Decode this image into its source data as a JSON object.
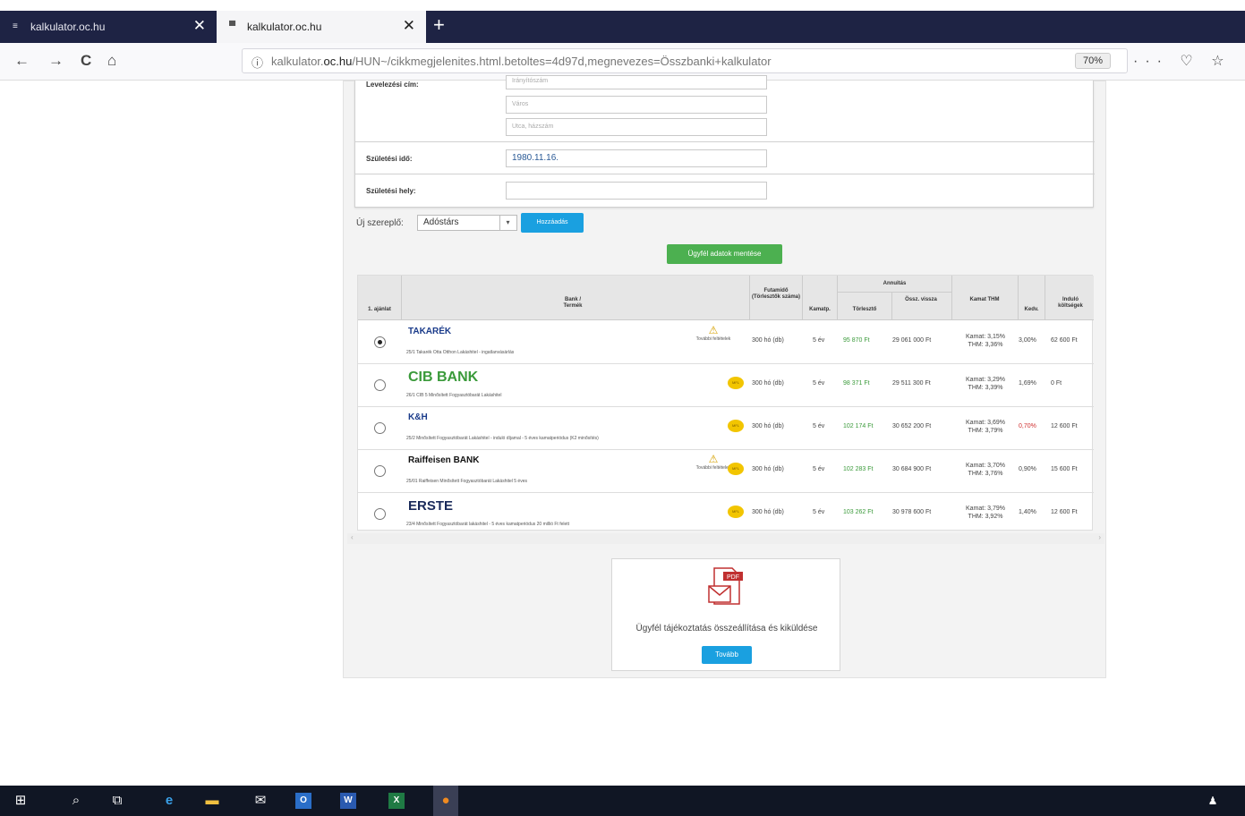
{
  "tabs": [
    {
      "title": "kalkulator.oc.hu",
      "close": "✕"
    },
    {
      "title": "kalkulator.oc.hu",
      "close": "✕"
    }
  ],
  "new_tab": "+",
  "nav": {
    "back": "←",
    "forward": "→",
    "reload": "C",
    "home": "⌂"
  },
  "url": {
    "prefix": "kalkulator.",
    "domain": "oc.hu",
    "path": "/HUN~/cikkmegjelenites.html.betoltes=4d97d,megnevezes=Összbanki+kalkulator"
  },
  "zoom": "70%",
  "menu_icons": "··· ♡ ☆",
  "form": {
    "address_label": "Levelezési cím:",
    "address_placeholders": [
      "Irányítószám",
      "Város",
      "Utca, házszám"
    ],
    "birth_date_label": "Születési idő:",
    "birth_date_value": "1980.11.16.",
    "birth_place_label": "Születési hely:",
    "birth_place_value": ""
  },
  "role": {
    "label": "Új szereplő:",
    "selected": "Adóstárs",
    "arrow": "▾",
    "add_button": "Hozzáadás",
    "save_button": "Ügyfél adatok mentése"
  },
  "table": {
    "headers": {
      "offer": "1. ajánlat",
      "bank": "Bank / Termék",
      "term": "Futamidő (Törlesztők száma)",
      "period": "Kamatp.",
      "annuity": "Annuitás",
      "repay": "Törlesztő",
      "total": "Össz. vissza",
      "rate": "Kamat THM",
      "discount": "Kedv.",
      "init_cost": "Induló költségek"
    },
    "rows": [
      {
        "selected": true,
        "logo": "TAKARÉK",
        "logo_color": "#1a3b8a",
        "product": "25/1 Takarék Otta Otthon Lakáshitel - ingatlanvásárlás",
        "warning": "További feltételek",
        "badge": "",
        "term": "300 hó (db)",
        "period": "5 év",
        "repay": "95 870 Ft",
        "total": "29 061 000 Ft",
        "rate": "Kamat: 3,15%",
        "thm": "THM: 3,36%",
        "discount": "3,00%",
        "discount_red": false,
        "init_cost": "62 600 Ft"
      },
      {
        "selected": false,
        "logo": "CIB BANK",
        "logo_color": "#3a9a3a",
        "product": "26/1 CIB 5 Minősített Fogyasztóbarát Lakáshitel",
        "warning": "",
        "badge": "MFL",
        "term": "300 hó (db)",
        "period": "5 év",
        "repay": "98 371 Ft",
        "total": "29 511 300 Ft",
        "rate": "Kamat: 3,29%",
        "thm": "THM: 3,39%",
        "discount": "1,69%",
        "discount_red": false,
        "init_cost": "0 Ft"
      },
      {
        "selected": false,
        "logo": "K&H",
        "logo_color": "#1a3b8a",
        "product": "25/2 Minősített Fogyasztóbarát Lakáshitel - induló díjamal - 5 éves kamatperiódus (K2 minősítés)",
        "warning": "",
        "badge": "MFL",
        "term": "300 hó (db)",
        "period": "5 év",
        "repay": "102 174 Ft",
        "total": "30 652 200 Ft",
        "rate": "Kamat: 3,69%",
        "thm": "THM: 3,79%",
        "discount": "0,70%",
        "discount_red": true,
        "init_cost": "12 600 Ft"
      },
      {
        "selected": false,
        "logo": "Raiffeisen BANK",
        "logo_color": "#111111",
        "product": "25/01 Raiffeisen Minősített Fogyasztóbarát Lakáshitel 5 éves",
        "warning": "További feltételek",
        "badge": "MFL",
        "term": "300 hó (db)",
        "period": "5 év",
        "repay": "102 283 Ft",
        "total": "30 684 900 Ft",
        "rate": "Kamat: 3,70%",
        "thm": "THM: 3,76%",
        "discount": "0,90%",
        "discount_red": false,
        "init_cost": "15 600 Ft"
      },
      {
        "selected": false,
        "logo": "ERSTE",
        "logo_color": "#1a2a5a",
        "product": "23/4 Minősített Fogyasztóbarát lakáshitel - 5 éves kamatperiódus 20 millió Ft felett",
        "warning": "",
        "badge": "MFL",
        "term": "300 hó (db)",
        "period": "5 év",
        "repay": "103 262 Ft",
        "total": "30 978 600 Ft",
        "rate": "Kamat: 3,79%",
        "thm": "THM: 3,92%",
        "discount": "1,40%",
        "discount_red": false,
        "init_cost": "12 600 Ft"
      }
    ]
  },
  "pdf_card": {
    "icon_label": "PDF",
    "text": "Ügyfél tájékoztatás összeállítása és kiküldése",
    "button": "Tovább"
  },
  "taskbar": {
    "start": "⊞",
    "search": "⌕",
    "taskview": "⧉",
    "edge": "e",
    "explorer": "▬",
    "mail": "✉",
    "outlook": "O",
    "word": "W",
    "excel": "X",
    "firefox": "●",
    "people": "♟"
  },
  "colors": {
    "tabbar": "#1e2344",
    "taskbar": "#101624",
    "accent_blue": "#1aa0e0",
    "accent_green": "#4cb050"
  }
}
